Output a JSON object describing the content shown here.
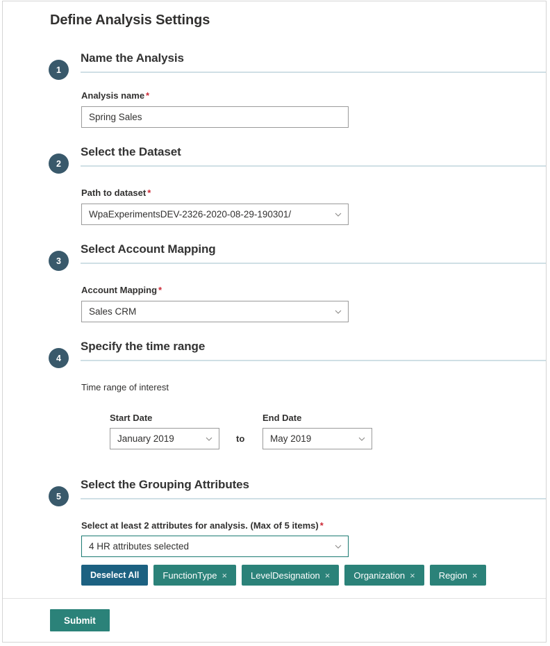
{
  "page": {
    "title": "Define Analysis Settings"
  },
  "colors": {
    "step_badge": "#39596b",
    "rule": "#cfdfe5",
    "required_asterisk": "#cc2936",
    "accent_teal": "#2b8279",
    "deselect_blue": "#1c6181",
    "border_gray": "#9a9a9a"
  },
  "steps": [
    {
      "number": "1",
      "heading": "Name the Analysis",
      "field_label": "Analysis name",
      "required_mark": "*",
      "value": "Spring Sales"
    },
    {
      "number": "2",
      "heading": "Select the Dataset",
      "field_label": "Path to dataset",
      "required_mark": "*",
      "value": "WpaExperimentsDEV-2326-2020-08-29-190301/"
    },
    {
      "number": "3",
      "heading": "Select Account Mapping",
      "field_label": "Account Mapping",
      "required_mark": "*",
      "value": "Sales CRM"
    },
    {
      "number": "4",
      "heading": "Specify the time range",
      "field_label": "Time range of interest",
      "start_label": "Start Date",
      "start_value": "January 2019",
      "to_label": "to",
      "end_label": "End Date",
      "end_value": "May 2019"
    },
    {
      "number": "5",
      "heading": "Select the Grouping Attributes",
      "field_label": "Select at least 2 attributes for analysis. (Max of 5 items)",
      "required_mark": "*",
      "value": "4 HR attributes selected"
    }
  ],
  "attributes": {
    "deselect_label": "Deselect All",
    "remove_glyph": "×",
    "tags": [
      {
        "label": "FunctionType"
      },
      {
        "label": "LevelDesignation"
      },
      {
        "label": "Organization"
      },
      {
        "label": "Region"
      }
    ]
  },
  "footer": {
    "submit_label": "Submit"
  }
}
